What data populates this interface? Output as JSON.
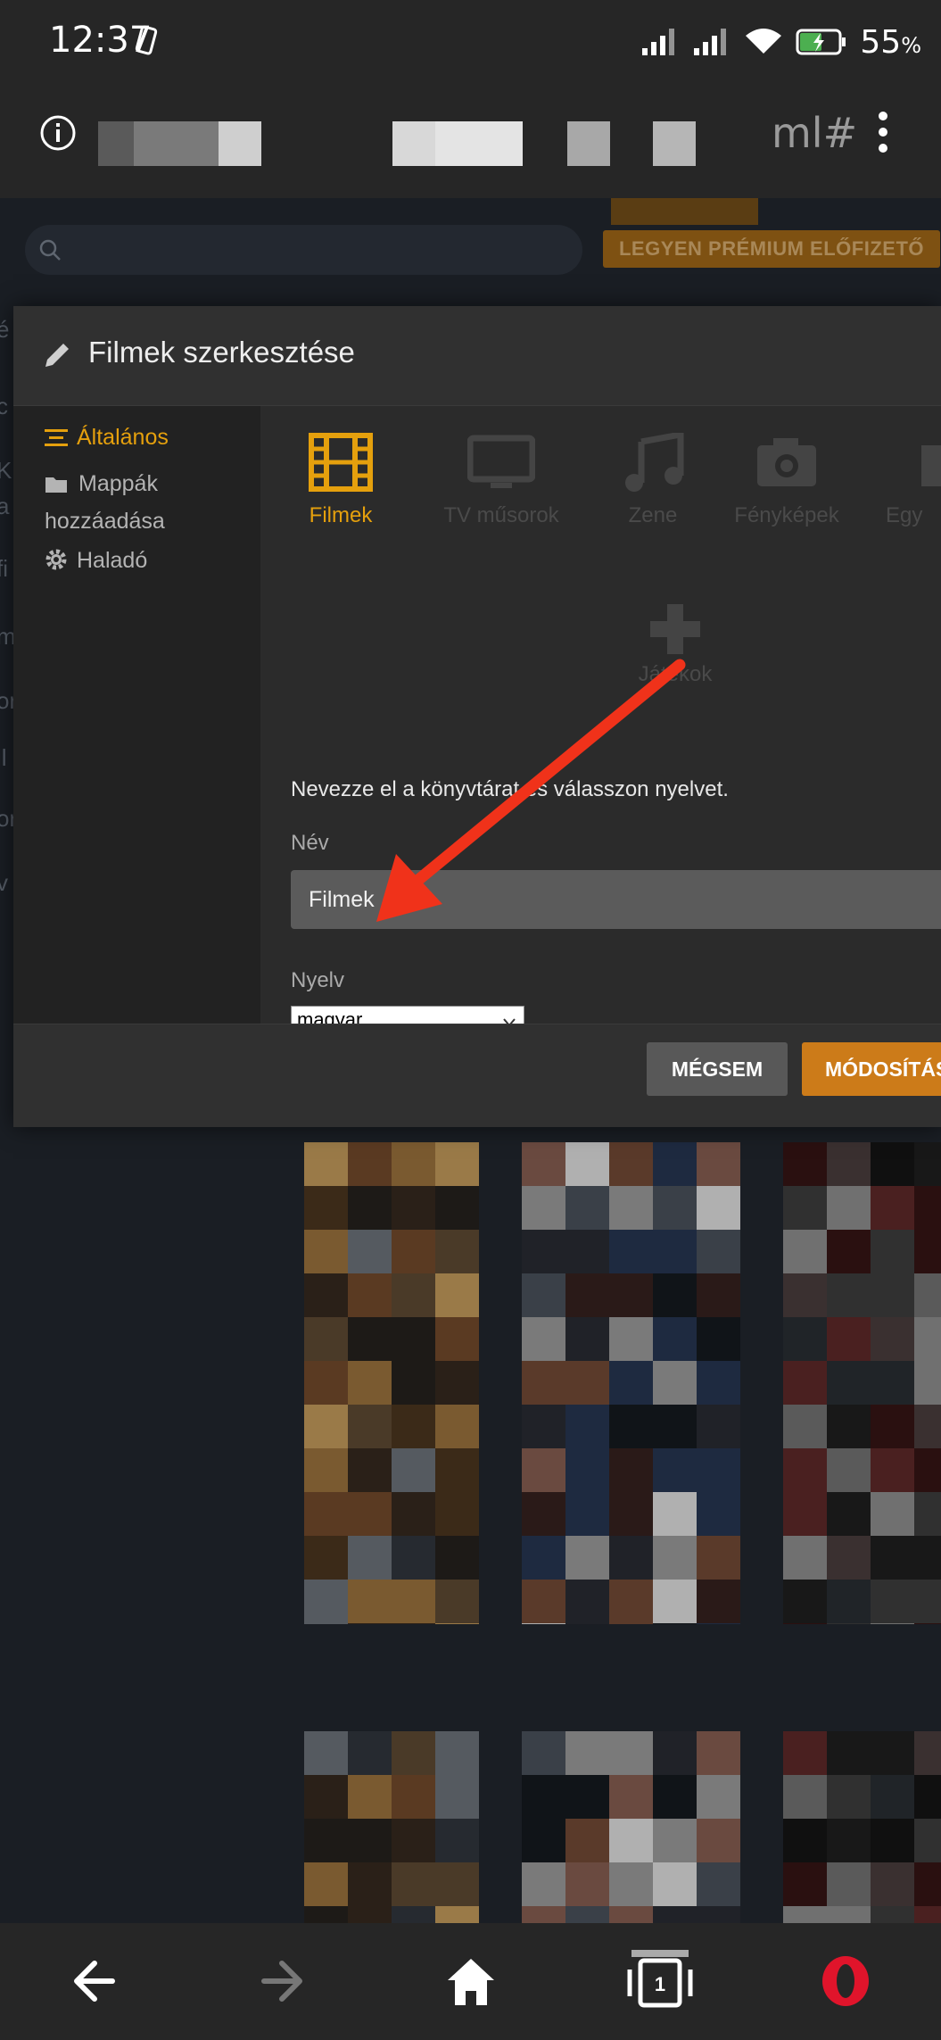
{
  "status_bar": {
    "time": "12:37",
    "battery_percent": "55",
    "battery_unit": "%"
  },
  "url_bar": {
    "visible_text": "ml#"
  },
  "page": {
    "premium_button": "LEGYEN PRÉMIUM ELŐFIZETŐ",
    "left_edge_letters": [
      "é",
      "c",
      "K",
      "a",
      "fi",
      "m",
      "or",
      "il",
      "or",
      "v"
    ]
  },
  "modal": {
    "title": "Filmek szerkesztése",
    "sidebar": [
      {
        "label": "Általános",
        "icon": "list-icon",
        "active": true
      },
      {
        "label_line1": "Mappák",
        "label_line2": "hozzáadása",
        "icon": "folder-icon",
        "active": false
      },
      {
        "label": "Haladó",
        "icon": "gear-icon",
        "active": false
      }
    ],
    "library_types": [
      {
        "label": "Filmek",
        "icon": "film-icon",
        "active": true
      },
      {
        "label": "TV műsorok",
        "icon": "tv-icon",
        "active": false
      },
      {
        "label": "Zene",
        "icon": "music-icon",
        "active": false
      },
      {
        "label": "Fényképek",
        "icon": "camera-icon",
        "active": false
      },
      {
        "label": "Egy",
        "icon": "other-icon",
        "active": false
      },
      {
        "label": "Játékok",
        "icon": "gamepad-icon",
        "active": false
      }
    ],
    "description": "Nevezze el a könyvtárat és válasszon nyelvet.",
    "name_label": "Név",
    "name_value": "Filmek",
    "language_label": "Nyelv",
    "language_value": "magyar",
    "cancel_label": "MÉGSEM",
    "save_label": "MÓDOSÍTÁS"
  },
  "colors": {
    "accent": "#e5a00d",
    "save_button": "#cc7b19",
    "arrow": "#f0321a"
  }
}
